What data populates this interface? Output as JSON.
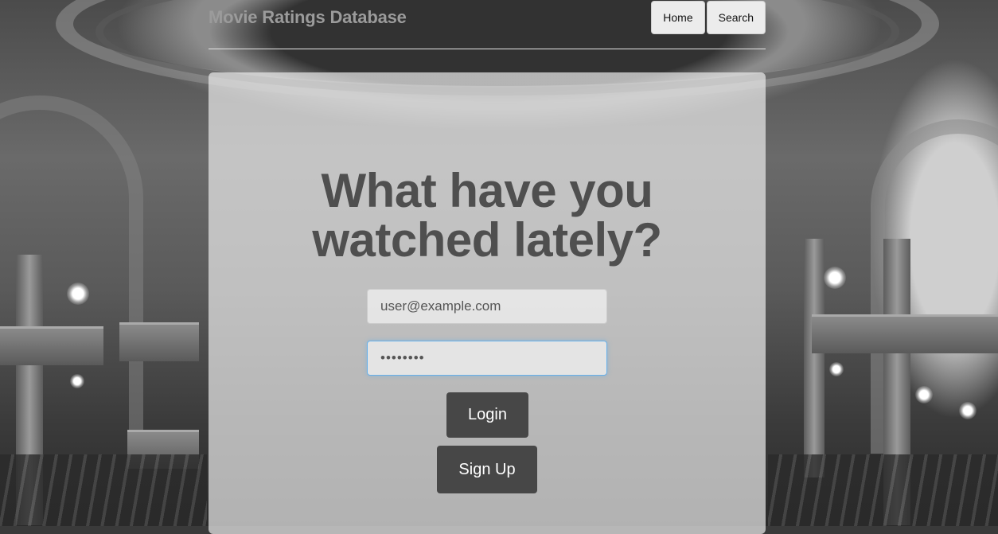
{
  "header": {
    "brand": "Movie Ratings Database",
    "nav": [
      {
        "label": "Home"
      },
      {
        "label": "Search"
      }
    ]
  },
  "main": {
    "headline_line1": "What have you",
    "headline_line2": "watched lately?",
    "email": {
      "value": "user@example.com",
      "placeholder": "user@example.com"
    },
    "password": {
      "value": "••••••••"
    },
    "login_label": "Login",
    "signup_label": "Sign Up"
  },
  "colors": {
    "button_dark": "#474747",
    "brand_text": "#9b9b9b",
    "headline_text": "#4f4f4f",
    "focus_ring": "#66afe9"
  }
}
